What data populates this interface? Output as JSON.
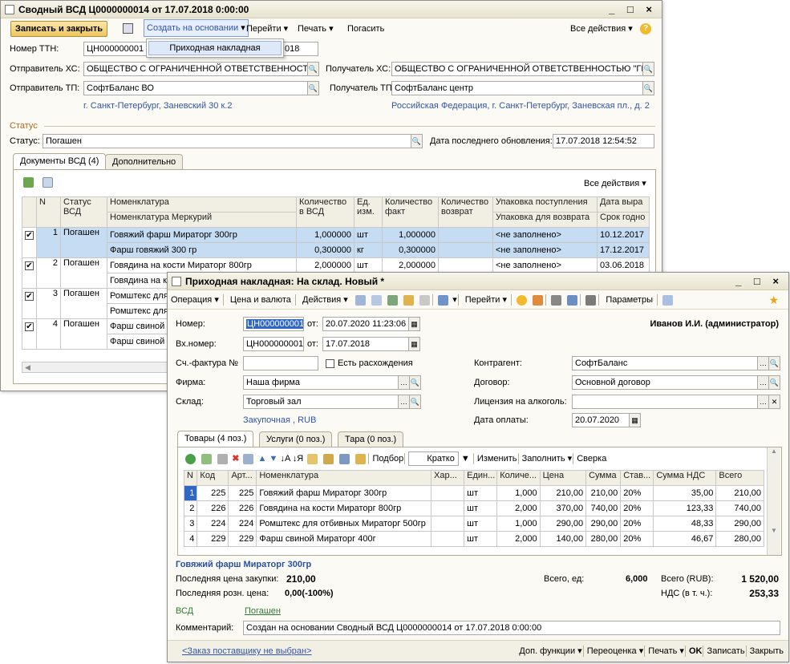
{
  "back": {
    "title": "Сводный ВСД Ц0000000014 от 17.07.2018 0:00:00",
    "window_controls": "_ □ ×",
    "toolbar": {
      "save_close": "Записать и закрыть",
      "create_basis": "Создать на основании",
      "goto": "Перейти",
      "print": "Печать",
      "repay": "Погасить",
      "all_actions": "Все действия",
      "help": "?"
    },
    "menu_item": "Приходная накладная",
    "ttn_label": "Номер ТТН:",
    "ttn_value": "ЦН000000001",
    "ttn_date": "018",
    "sender_hs_label": "Отправитель ХС:",
    "sender_hs_value": "ОБЩЕСТВО С ОГРАНИЧЕННОЙ ОТВЕТСТВЕННОСТЬ",
    "receiver_hs_label": "Получатель ХС:",
    "receiver_hs_value": "ОБЩЕСТВО С ОГРАНИЧЕННОЙ ОТВЕТСТВЕННОСТЬЮ \"ГК С",
    "sender_tp_label": "Отправитель ТП:",
    "sender_tp_value": "СофтБаланс ВО",
    "receiver_tp_label": "Получатель ТП:",
    "receiver_tp_value": "СофтБаланс центр",
    "sender_addr": "г. Санкт-Петербург, Заневский 30 к.2",
    "receiver_addr": "Российская Федерация, г. Санкт-Петербург, Заневская пл., д. 2",
    "status_group": "Статус",
    "status_label": "Статус:",
    "status_value": "Погашен",
    "updated_label": "Дата последнего обновления:",
    "updated_value": "17.07.2018 12:54:52",
    "tabs": [
      "Документы ВСД (4)",
      "Дополнительно"
    ],
    "all_actions2": "Все действия",
    "cols": {
      "n": "N",
      "status": "Статус ВСД",
      "nom": "Номенклатура",
      "nom2": "Номенклатура Меркурий",
      "qty": "Количество в ВСД",
      "unit": "Ед. изм.",
      "qty_fact": "Количество факт",
      "qty_ret": "Количество возврат",
      "pack": "Упаковка поступления",
      "pack2": "Упаковка для возврата",
      "date": "Дата выра",
      "date2": "Срок годно"
    },
    "rows": [
      {
        "n": "1",
        "status": "Погашен",
        "nom": "Говяжий фарш Мираторг 300гр",
        "nom2": "Фарш говяжий 300 гр",
        "qty": "1,000000",
        "qty2": "0,300000",
        "unit": "шт",
        "unit2": "кг",
        "fact": "1,000000",
        "fact2": "0,300000",
        "pack": "<не заполнено>",
        "pack2": "<не заполнено>",
        "date": "10.12.2017",
        "date2": "17.12.2017"
      },
      {
        "n": "2",
        "status": "Погашен",
        "nom": "Говядина на кости Мираторг 800гр",
        "nom2": "Говядина на ко",
        "qty": "2,000000",
        "unit": "шт",
        "fact": "2,000000",
        "pack": "<не заполнено>",
        "date": "03.06.2018"
      },
      {
        "n": "3",
        "status": "Погашен",
        "nom": "Ромштекс для",
        "nom2": "Ромштекс для"
      },
      {
        "n": "4",
        "status": "Погашен",
        "nom": "Фарш свиной",
        "nom2": "Фарш свиной"
      }
    ]
  },
  "front": {
    "title": "Приходная накладная: На склад. Новый *",
    "window_controls": "_ □ ×",
    "toolbar": {
      "operation": "Операция",
      "price": "Цена и валюта",
      "actions": "Действия",
      "goto": "Перейти",
      "params": "Параметры"
    },
    "number_label": "Номер:",
    "number_value": "ЦН000000001",
    "from_label": "от:",
    "number_date": "20.07.2020 11:23:06",
    "user": "Иванов И.И. (администратор)",
    "in_number_label": "Вх.номер:",
    "in_number_value": "ЦН000000001",
    "in_date": "17.07.2018",
    "invoice_label": "Сч.-фактура №",
    "discrepancy_label": "Есть расхождения",
    "counterparty_label": "Контрагент:",
    "counterparty_value": "СофтБаланс",
    "firm_label": "Фирма:",
    "firm_value": "Наша фирма",
    "contract_label": "Договор:",
    "contract_value": "Основной договор",
    "warehouse_label": "Склад:",
    "warehouse_value": "Торговый зал",
    "license_label": "Лицензия на алкоголь:",
    "license_value": "",
    "price_type": "Закупочная , RUB",
    "pay_date_label": "Дата оплаты:",
    "pay_date_value": "20.07.2020",
    "tabs": [
      "Товары (4 поз.)",
      "Услуги (0 поз.)",
      "Тара (0 поз.)"
    ],
    "grid_toolbar": {
      "select": "Подбор",
      "brief": "Кратко",
      "change": "Изменить",
      "fill": "Заполнить",
      "check": "Сверка"
    },
    "cols": {
      "n": "N",
      "code": "Код",
      "art": "Арт...",
      "nom": "Номенклатура",
      "char": "Хар...",
      "unit": "Един...",
      "qty": "Количе...",
      "price": "Цена",
      "sum": "Сумма",
      "rate": "Став...",
      "vat": "Сумма НДС",
      "total": "Всего"
    },
    "rows": [
      {
        "n": "1",
        "code": "225",
        "art": "225",
        "nom": "Говяжий фарш Мираторг 300гр",
        "unit": "шт",
        "qty": "1,000",
        "price": "210,00",
        "sum": "210,00",
        "rate": "20%",
        "vat": "35,00",
        "total": "210,00"
      },
      {
        "n": "2",
        "code": "226",
        "art": "226",
        "nom": "Говядина на кости Мираторг 800гр",
        "unit": "шт",
        "qty": "2,000",
        "price": "370,00",
        "sum": "740,00",
        "rate": "20%",
        "vat": "123,33",
        "total": "740,00"
      },
      {
        "n": "3",
        "code": "224",
        "art": "224",
        "nom": "Ромштекс для отбивных Мираторг 500гр",
        "unit": "шт",
        "qty": "1,000",
        "price": "290,00",
        "sum": "290,00",
        "rate": "20%",
        "vat": "48,33",
        "total": "290,00"
      },
      {
        "n": "4",
        "code": "229",
        "art": "229",
        "nom": "Фарш свиной Мираторг 400г",
        "unit": "шт",
        "qty": "2,000",
        "price": "140,00",
        "sum": "280,00",
        "rate": "20%",
        "vat": "46,67",
        "total": "280,00"
      }
    ],
    "selected_item": "Говяжий фарш Мираторг 300гр",
    "last_buy_label": "Последняя цена закупки:",
    "last_buy_value": "210,00",
    "last_retail_label": "Последняя розн. цена:",
    "last_retail_value": "0,00(-100%)",
    "total_units_label": "Всего, ед:",
    "total_units_value": "6,000",
    "total_rub_label": "Всего (RUB):",
    "total_rub_value": "1 520,00",
    "vat_label": "НДС (в т. ч.):",
    "vat_value": "253,33",
    "vsd_label": "ВСД",
    "vsd_value": "Погашен",
    "comment_label": "Комментарий:",
    "comment_value": "Создан на основании Сводный ВСД Ц0000000014 от 17.07.2018 0:00:00",
    "bottom": {
      "order": "<Заказ поставщику не выбран>",
      "extra": "Доп. функции",
      "reprice": "Переоценка",
      "print": "Печать",
      "ok": "OK",
      "save": "Записать",
      "close": "Закрыть"
    }
  }
}
